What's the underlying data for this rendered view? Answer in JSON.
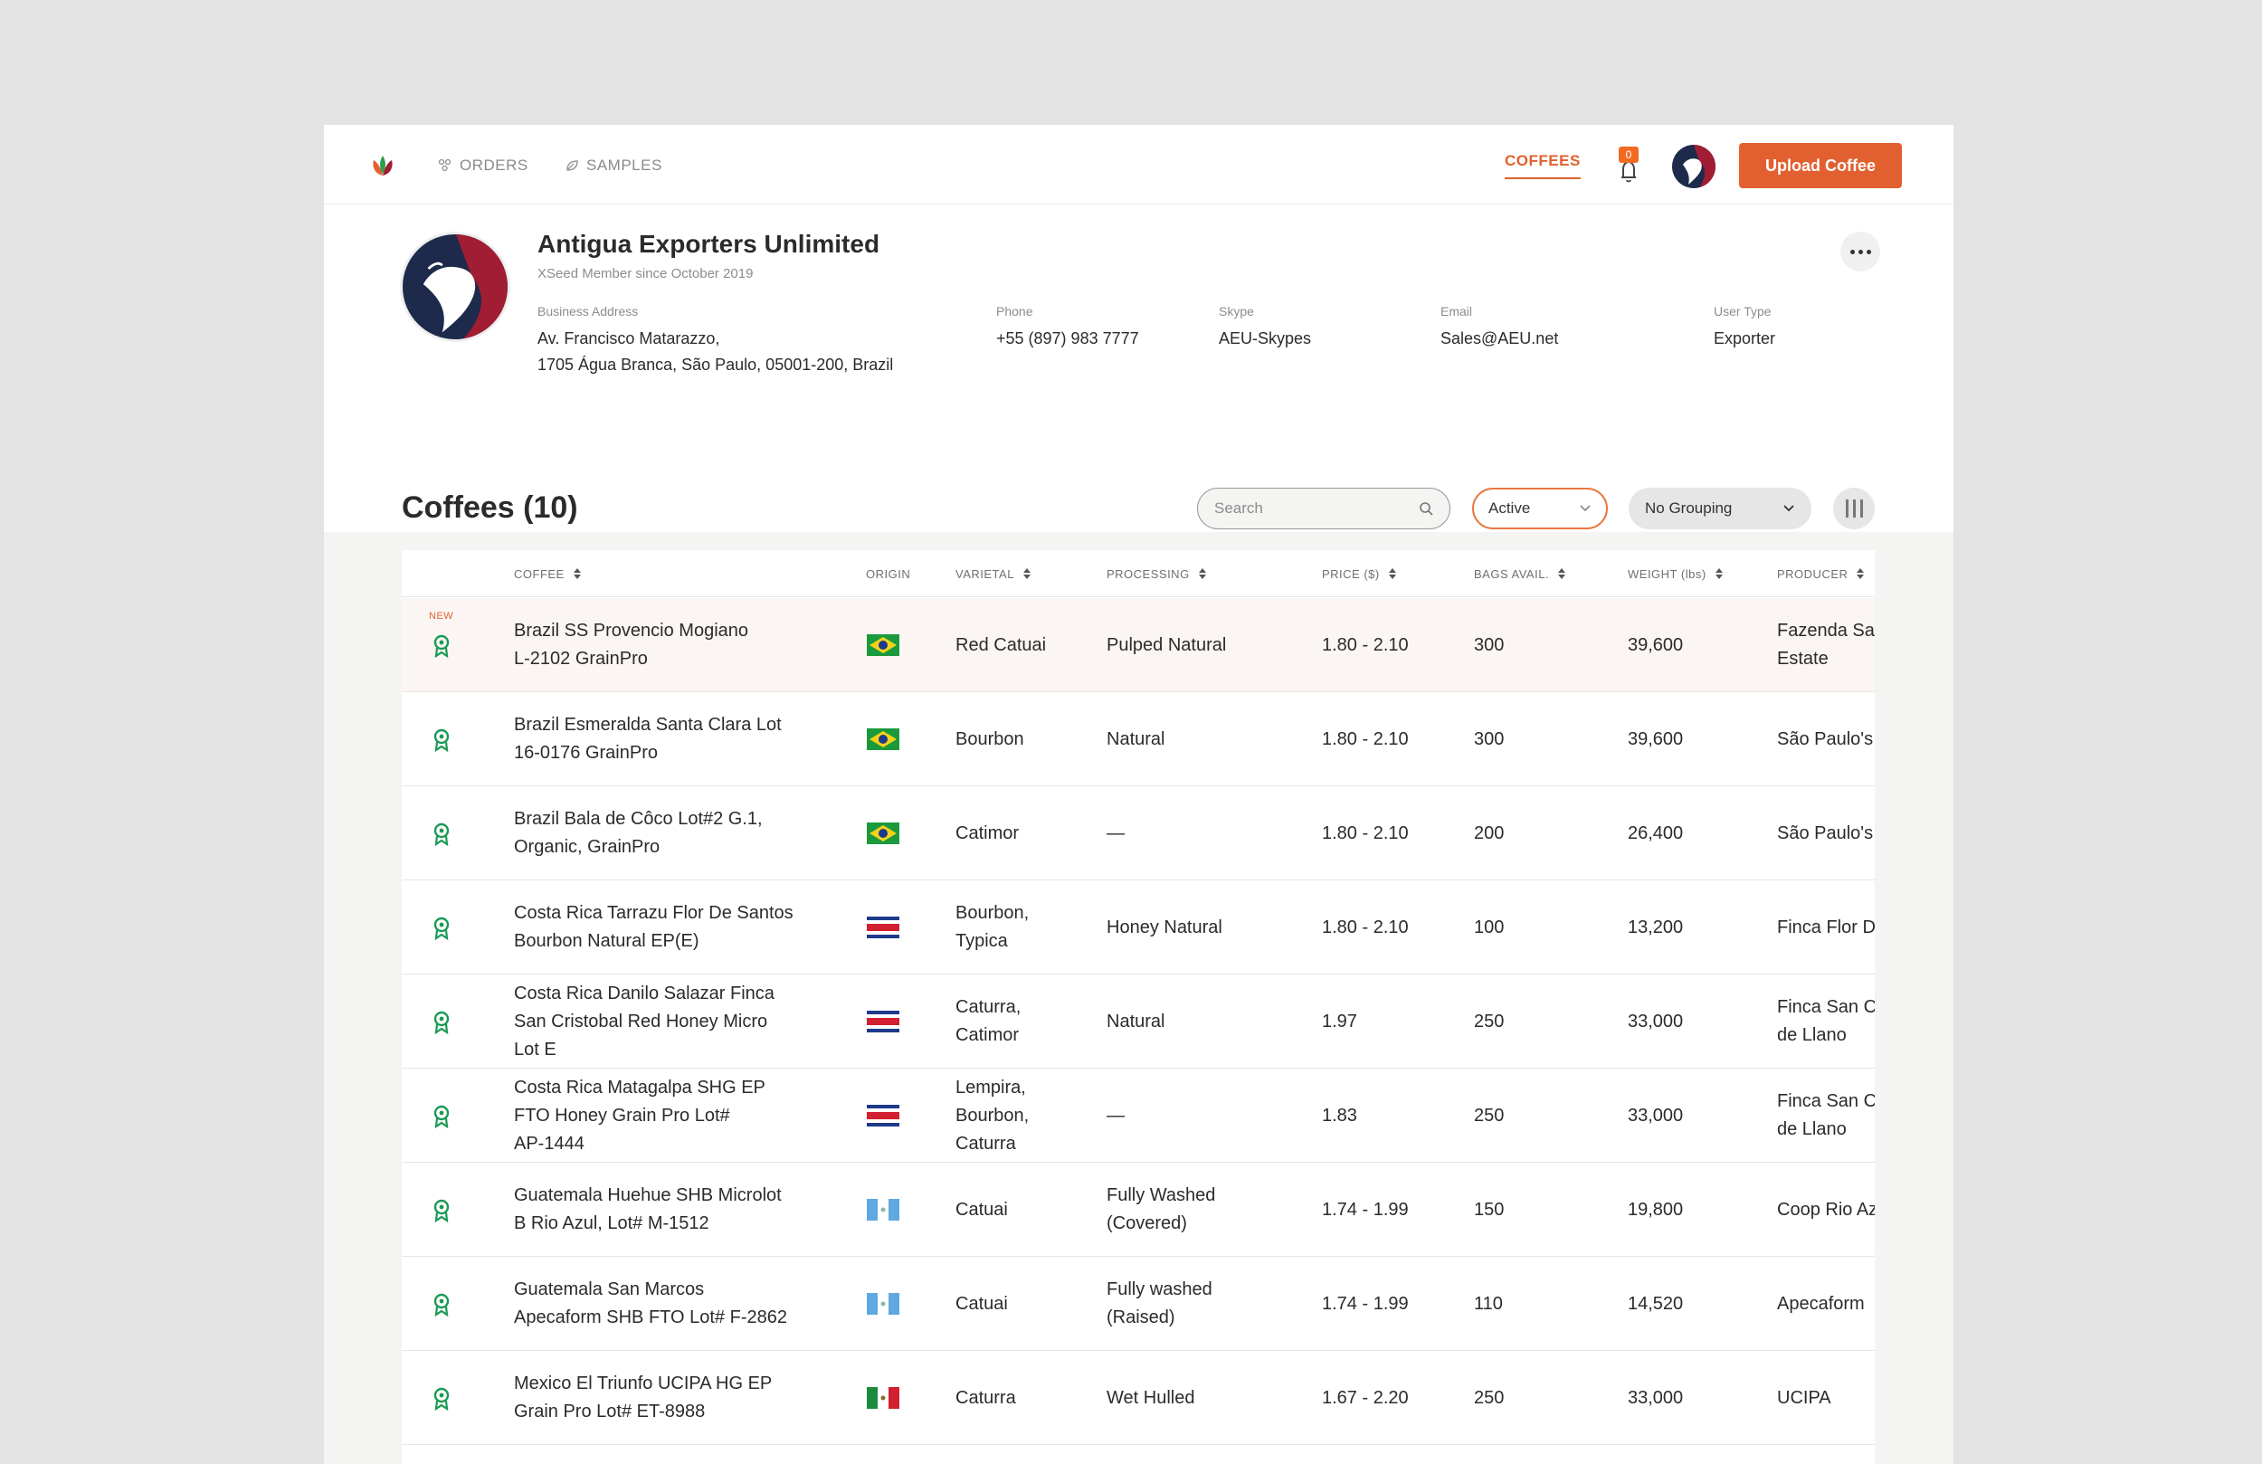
{
  "nav": {
    "orders_label": "ORDERS",
    "samples_label": "SAMPLES",
    "coffees_label": "COFFEES",
    "notification_count": "0",
    "upload_label": "Upload Coffee"
  },
  "profile": {
    "company": "Antigua Exporters Unlimited",
    "member_since": "XSeed Member since October 2019",
    "address_label": "Business Address",
    "address_line1": "Av. Francisco Matarazzo,",
    "address_line2": "1705 Água Branca, São Paulo, 05001-200, Brazil",
    "phone_label": "Phone",
    "phone": "+55 (897) 983 7777",
    "skype_label": "Skype",
    "skype": "AEU-Skypes",
    "email_label": "Email",
    "email": "Sales@AEU.net",
    "usertype_label": "User Type",
    "usertype": "Exporter"
  },
  "coffees": {
    "title": "Coffees (10)",
    "search_placeholder": "Search",
    "status_value": "Active",
    "grouping_value": "No Grouping",
    "columns": {
      "coffee": "COFFEE",
      "origin": "ORIGIN",
      "varietal": "VARIETAL",
      "processing": "PROCESSING",
      "price": "PRICE ($)",
      "bags": "BAGS AVAIL.",
      "weight": "WEIGHT (lbs)",
      "producer": "PRODUCER"
    },
    "new_tag": "NEW",
    "rows": [
      {
        "coffee": [
          "Brazil SS Provencio Mogiano",
          "L-2102 GrainPro"
        ],
        "origin": "brazil",
        "varietal": [
          "Red Catuai"
        ],
        "processing": [
          "Pulped Natural"
        ],
        "price": "1.80 - 2.10",
        "bags": "300",
        "weight": "39,600",
        "producer": [
          "Fazenda Sa",
          "Estate"
        ],
        "is_new": true
      },
      {
        "coffee": [
          "Brazil Esmeralda Santa Clara Lot",
          "16-0176 GrainPro"
        ],
        "origin": "brazil",
        "varietal": [
          "Bourbon"
        ],
        "processing": [
          "Natural"
        ],
        "price": "1.80 - 2.10",
        "bags": "300",
        "weight": "39,600",
        "producer": [
          "São Paulo's"
        ],
        "is_new": false
      },
      {
        "coffee": [
          "Brazil Bala de Côco Lot#2 G.1,",
          "Organic, GrainPro"
        ],
        "origin": "brazil",
        "varietal": [
          "Catimor"
        ],
        "processing": [
          "—"
        ],
        "price": "1.80 - 2.10",
        "bags": "200",
        "weight": "26,400",
        "producer": [
          "São Paulo's"
        ],
        "is_new": false
      },
      {
        "coffee": [
          "Costa Rica Tarrazu Flor De Santos",
          "Bourbon Natural EP(E)"
        ],
        "origin": "costa-rica",
        "varietal": [
          "Bourbon,",
          "Typica"
        ],
        "processing": [
          "Honey Natural"
        ],
        "price": "1.80 - 2.10",
        "bags": "100",
        "weight": "13,200",
        "producer": [
          "Finca Flor D"
        ],
        "is_new": false
      },
      {
        "coffee": [
          "Costa Rica Danilo Salazar Finca",
          "San Cristobal Red Honey Micro",
          "Lot E"
        ],
        "origin": "costa-rica",
        "varietal": [
          "Caturra,",
          "Catimor"
        ],
        "processing": [
          "Natural"
        ],
        "price": "1.97",
        "bags": "250",
        "weight": "33,000",
        "producer": [
          "Finca San C",
          "de Llano"
        ],
        "is_new": false
      },
      {
        "coffee": [
          "Costa Rica Matagalpa SHG EP",
          "FTO Honey Grain Pro Lot#",
          "AP-1444"
        ],
        "origin": "costa-rica",
        "varietal": [
          "Lempira,",
          "Bourbon,",
          "Caturra"
        ],
        "processing": [
          "—"
        ],
        "price": "1.83",
        "bags": "250",
        "weight": "33,000",
        "producer": [
          "Finca San C",
          "de Llano"
        ],
        "is_new": false
      },
      {
        "coffee": [
          "Guatemala Huehue SHB Microlot",
          "B Rio Azul, Lot# M-1512"
        ],
        "origin": "guatemala",
        "varietal": [
          "Catuai"
        ],
        "processing": [
          "Fully Washed",
          "(Covered)"
        ],
        "price": "1.74 - 1.99",
        "bags": "150",
        "weight": "19,800",
        "producer": [
          "Coop Rio Az"
        ],
        "is_new": false
      },
      {
        "coffee": [
          "Guatemala San Marcos",
          "Apecaform SHB FTO Lot# F-2862"
        ],
        "origin": "guatemala",
        "varietal": [
          "Catuai"
        ],
        "processing": [
          "Fully washed",
          "(Raised)"
        ],
        "price": "1.74 - 1.99",
        "bags": "110",
        "weight": "14,520",
        "producer": [
          "Apecaform"
        ],
        "is_new": false
      },
      {
        "coffee": [
          "Mexico El Triunfo UCIPA HG EP",
          "Grain Pro Lot# ET-8988"
        ],
        "origin": "mexico",
        "varietal": [
          "Caturra"
        ],
        "processing": [
          "Wet Hulled"
        ],
        "price": "1.67 - 2.20",
        "bags": "250",
        "weight": "33,000",
        "producer": [
          "UCIPA"
        ],
        "is_new": false
      }
    ]
  },
  "colors": {
    "accent": "#e2602f",
    "award_green": "#1a9a55",
    "highlight_row": "#fbf6f3",
    "brand_navy": "#1d2a4c",
    "brand_red": "#a11d33"
  },
  "icons": {
    "orders": "orders-icon",
    "samples": "leaf-icon",
    "bell": "bell-icon",
    "search": "search-icon",
    "award": "award-icon",
    "more": "more-dots-icon",
    "columns": "columns-icon",
    "chevron": "chevron-down-icon"
  }
}
